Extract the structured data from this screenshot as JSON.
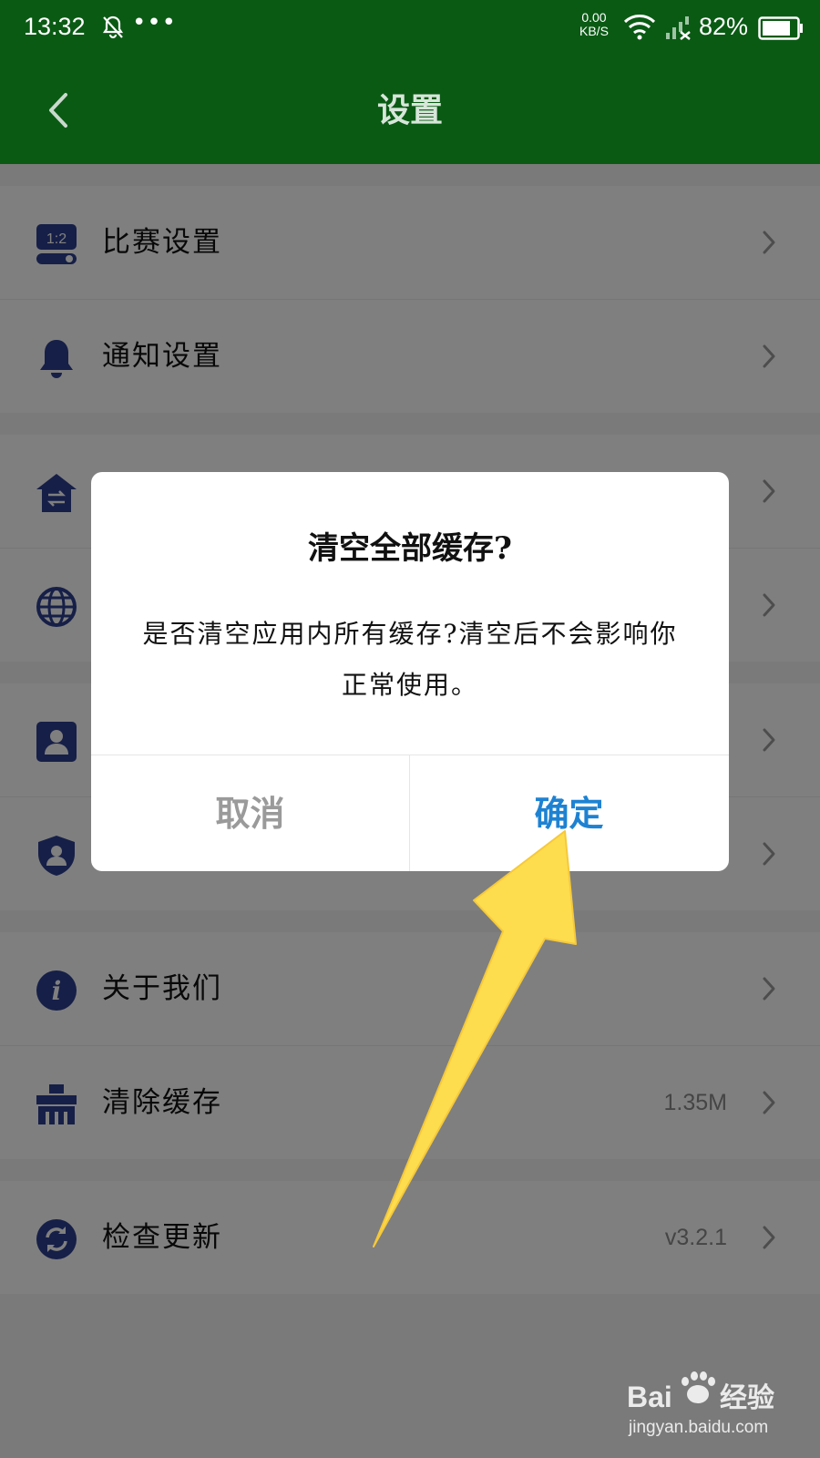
{
  "status_bar": {
    "time": "13:32",
    "dots": "•••",
    "speed_value": "0.00",
    "speed_unit": "KB/S",
    "battery": "82%",
    "bell_icon": "bell-off-icon",
    "wifi_icon": "wifi-icon",
    "signal_icon": "signal-no-sim-icon",
    "battery_icon": "battery-icon"
  },
  "header": {
    "title": "设置",
    "back_icon": "chevron-left-icon",
    "background": "#0a5a14"
  },
  "settings": {
    "groups": [
      {
        "items": [
          {
            "label": "比赛设置",
            "icon": "match-score-icon",
            "icon_text": "1:2"
          },
          {
            "label": "通知设置",
            "icon": "bell-icon"
          }
        ]
      },
      {
        "items": [
          {
            "label": "",
            "icon": "home-switch-icon"
          },
          {
            "label": "",
            "icon": "globe-icon"
          }
        ]
      },
      {
        "items": [
          {
            "label": "",
            "icon": "profile-card-icon"
          },
          {
            "label": "",
            "icon": "shield-user-icon"
          }
        ]
      },
      {
        "items": [
          {
            "label": "关于我们",
            "icon": "info-icon",
            "icon_text": "i"
          },
          {
            "label": "清除缓存",
            "icon": "broom-icon",
            "value": "1.35M"
          }
        ]
      },
      {
        "items": [
          {
            "label": "检查更新",
            "icon": "refresh-icon",
            "value": "v3.2.1"
          }
        ]
      }
    ],
    "icon_color": "#2c3e8f",
    "chevron_icon": "chevron-right-icon"
  },
  "dialog": {
    "title": "清空全部缓存?",
    "message": "是否清空应用内所有缓存?清空后不会影响你正常使用。",
    "cancel_label": "取消",
    "confirm_label": "确定",
    "confirm_color": "#1e82d2",
    "cancel_color": "#9a9a9a"
  },
  "annotation": {
    "arrow_color": "#fddc4e",
    "arrow_icon": "pointer-arrow-icon"
  },
  "watermark": {
    "brand_left": "Bai",
    "brand_right": "经验",
    "url": "jingyan.baidu.com",
    "icon": "paw-icon"
  }
}
